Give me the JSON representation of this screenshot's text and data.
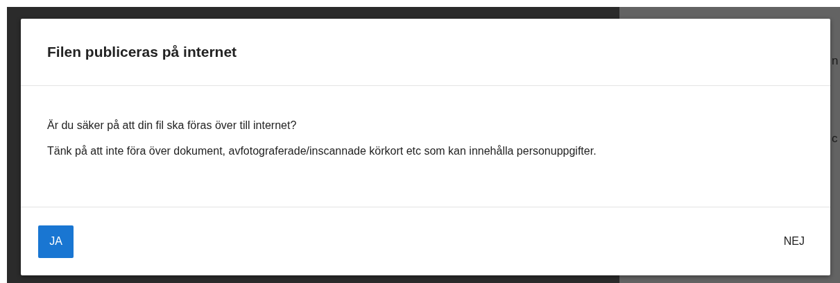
{
  "background": {
    "fragments": [
      "n",
      "c"
    ]
  },
  "dialog": {
    "title": "Filen publiceras på internet",
    "paragraphs": [
      "Är du säker på att din fil ska föras över till internet?",
      "Tänk på att inte föra över dokument, avfotograferade/inscannade körkort etc som kan innehålla personuppgifter."
    ],
    "buttons": [
      {
        "label": "JA",
        "kind": "primary"
      },
      {
        "label": "NEJ",
        "kind": "flat"
      }
    ]
  }
}
